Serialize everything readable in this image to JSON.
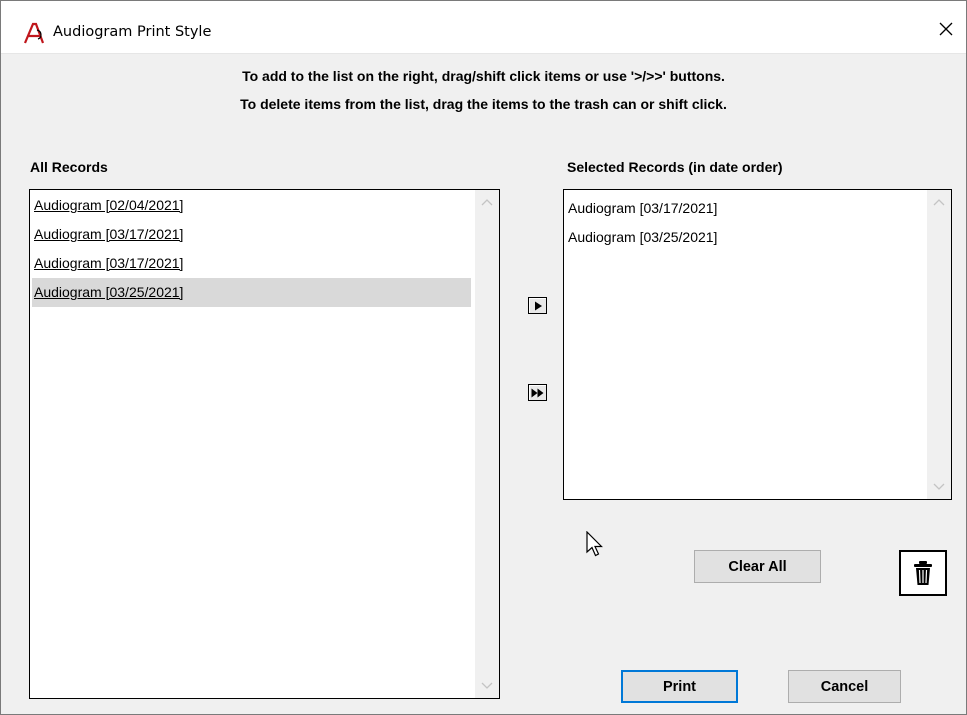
{
  "window": {
    "title": "Audiogram Print Style",
    "close_glyph": "✕"
  },
  "instructions": {
    "line1": "To add to the list on the right, drag/shift click items or use '>/>>' buttons.",
    "line2": "To delete items from the list, drag the items to the trash can or shift click."
  },
  "all_records": {
    "label": "All Records",
    "items": [
      {
        "text": "Audiogram  [02/04/2021]",
        "selected": false
      },
      {
        "text": "Audiogram  [03/17/2021]",
        "selected": false
      },
      {
        "text": "Audiogram  [03/17/2021]",
        "selected": false
      },
      {
        "text": "Audiogram  [03/25/2021]",
        "selected": true
      }
    ]
  },
  "selected_records": {
    "label": "Selected Records (in date order)",
    "items": [
      {
        "text": "Audiogram  [03/17/2021]"
      },
      {
        "text": "Audiogram  [03/25/2021]"
      }
    ]
  },
  "buttons": {
    "add_one_icon": "play-icon",
    "add_all_icon": "fast-forward-icon",
    "clear_all": "Clear All",
    "trash_icon": "trash-can-icon",
    "print": "Print",
    "cancel": "Cancel"
  },
  "colors": {
    "app_icon_red": "#c0161c",
    "focus_border": "#0078d7",
    "selected_row": "#d9d9d9"
  }
}
